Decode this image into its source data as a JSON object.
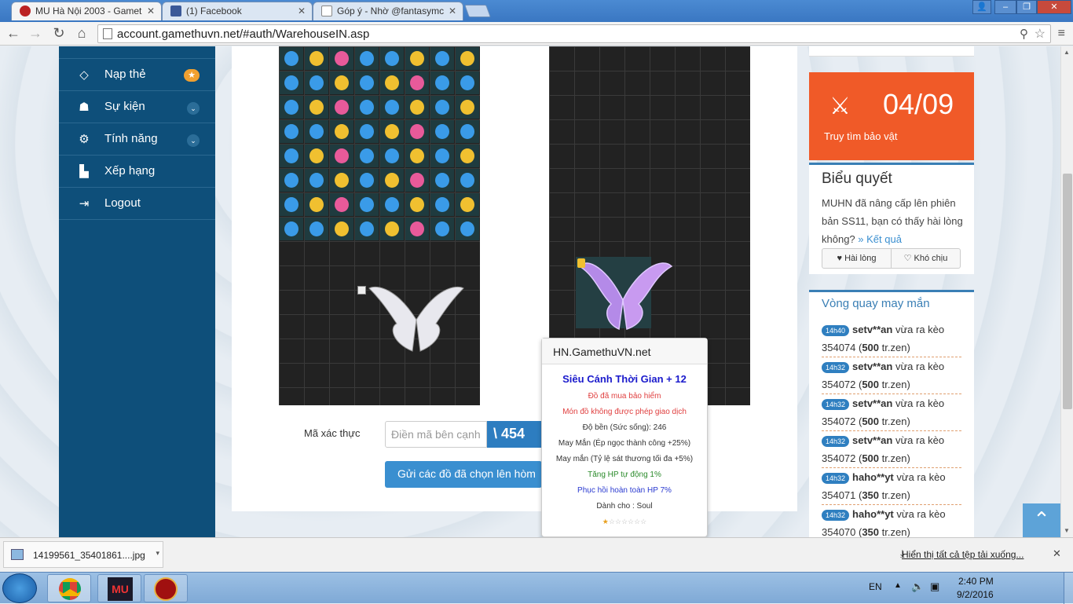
{
  "browser": {
    "tabs": [
      {
        "title": "MU Hà Nội 2003 - Gamet",
        "active": true
      },
      {
        "title": "(1) Facebook",
        "active": false
      },
      {
        "title": "Góp ý - Nhờ @fantasymc",
        "active": false
      }
    ],
    "url": "account.gamethuvn.net/#auth/WarehouseIN.asp"
  },
  "sidebar": {
    "items": [
      {
        "label": "Nạp thẻ",
        "icon": "diamond-icon",
        "badge": "★"
      },
      {
        "label": "Sự kiện",
        "icon": "android-icon",
        "badge": "⌄"
      },
      {
        "label": "Tính năng",
        "icon": "gears-icon",
        "badge": "⌄"
      },
      {
        "label": "Xếp hạng",
        "icon": "bar-chart-icon"
      },
      {
        "label": "Logout",
        "icon": "logout-icon"
      }
    ]
  },
  "warehouse": {
    "captcha_label": "Mã xác thực",
    "captcha_placeholder": "Điền mã bên cạnh",
    "captcha_code": "\\ 454",
    "submit_label": "Gửi các đồ đã chọn lên hòm"
  },
  "tooltip": {
    "header": "HN.GamethuVN.net",
    "item_name": "Siêu Cánh Thời Gian + 12",
    "lines": [
      {
        "text": "Đồ đã mua bảo hiểm",
        "color": "#e04040"
      },
      {
        "text": "Món đồ không được phép giao dịch",
        "color": "#e04040"
      },
      {
        "text": "Độ bền (Sức sống): 246",
        "color": "#333333"
      },
      {
        "text": "May Mắn (Ép ngọc thành công +25%)",
        "color": "#333333"
      },
      {
        "text": "May mắn (Tỷ lệ sát thương tối đa +5%)",
        "color": "#333333"
      },
      {
        "text": "Tăng HP tự động 1%",
        "color": "#2a8a2a"
      },
      {
        "text": "Phục hồi hoàn toàn HP 7%",
        "color": "#2a3ad0"
      },
      {
        "text": "Dành cho : Soul",
        "color": "#333333"
      }
    ],
    "stars": "★☆☆☆☆☆☆",
    "stars_filled": 1
  },
  "countdown": {
    "date": "04/09",
    "label": "Truy tìm bảo vật"
  },
  "vote": {
    "title": "Biểu quyết",
    "question": "MUHN đã nâng cấp lên phiên bản SS11, bạn có thấy hài lòng không?",
    "result_link": "» Kết quả",
    "option1": "Hài lòng",
    "option2": "Khó chịu"
  },
  "lucky": {
    "title": "Vòng quay may mắn",
    "entries": [
      {
        "time": "14h40",
        "user": "setv**an",
        "mid": " vừa ra kèo 354074 (",
        "amount": "500",
        "unit": " tr.zen)"
      },
      {
        "time": "14h32",
        "user": "setv**an",
        "mid": " vừa ra kèo 354072 (",
        "amount": "500",
        "unit": " tr.zen)"
      },
      {
        "time": "14h32",
        "user": "setv**an",
        "mid": " vừa ra kèo 354072 (",
        "amount": "500",
        "unit": " tr.zen)"
      },
      {
        "time": "14h32",
        "user": "setv**an",
        "mid": " vừa ra kèo 354072 (",
        "amount": "500",
        "unit": " tr.zen)"
      },
      {
        "time": "14h32",
        "user": "haho**yt",
        "mid": " vừa ra kèo 354071 (",
        "amount": "350",
        "unit": " tr.zen)"
      },
      {
        "time": "14h32",
        "user": "haho**yt",
        "mid": " vừa ra kèo 354070 (",
        "amount": "350",
        "unit": " tr.zen)"
      }
    ]
  },
  "downloads": {
    "file": "14199561_35401861....jpg",
    "show_all": "Hiển thị tất cả tệp tải xuống..."
  },
  "taskbar": {
    "lang": "EN",
    "time": "2:40 PM",
    "date": "9/2/2016"
  },
  "colors": {
    "sidebar": "#0e4f7a",
    "countdown": "#f05a28",
    "accent": "#3a8fd0"
  }
}
